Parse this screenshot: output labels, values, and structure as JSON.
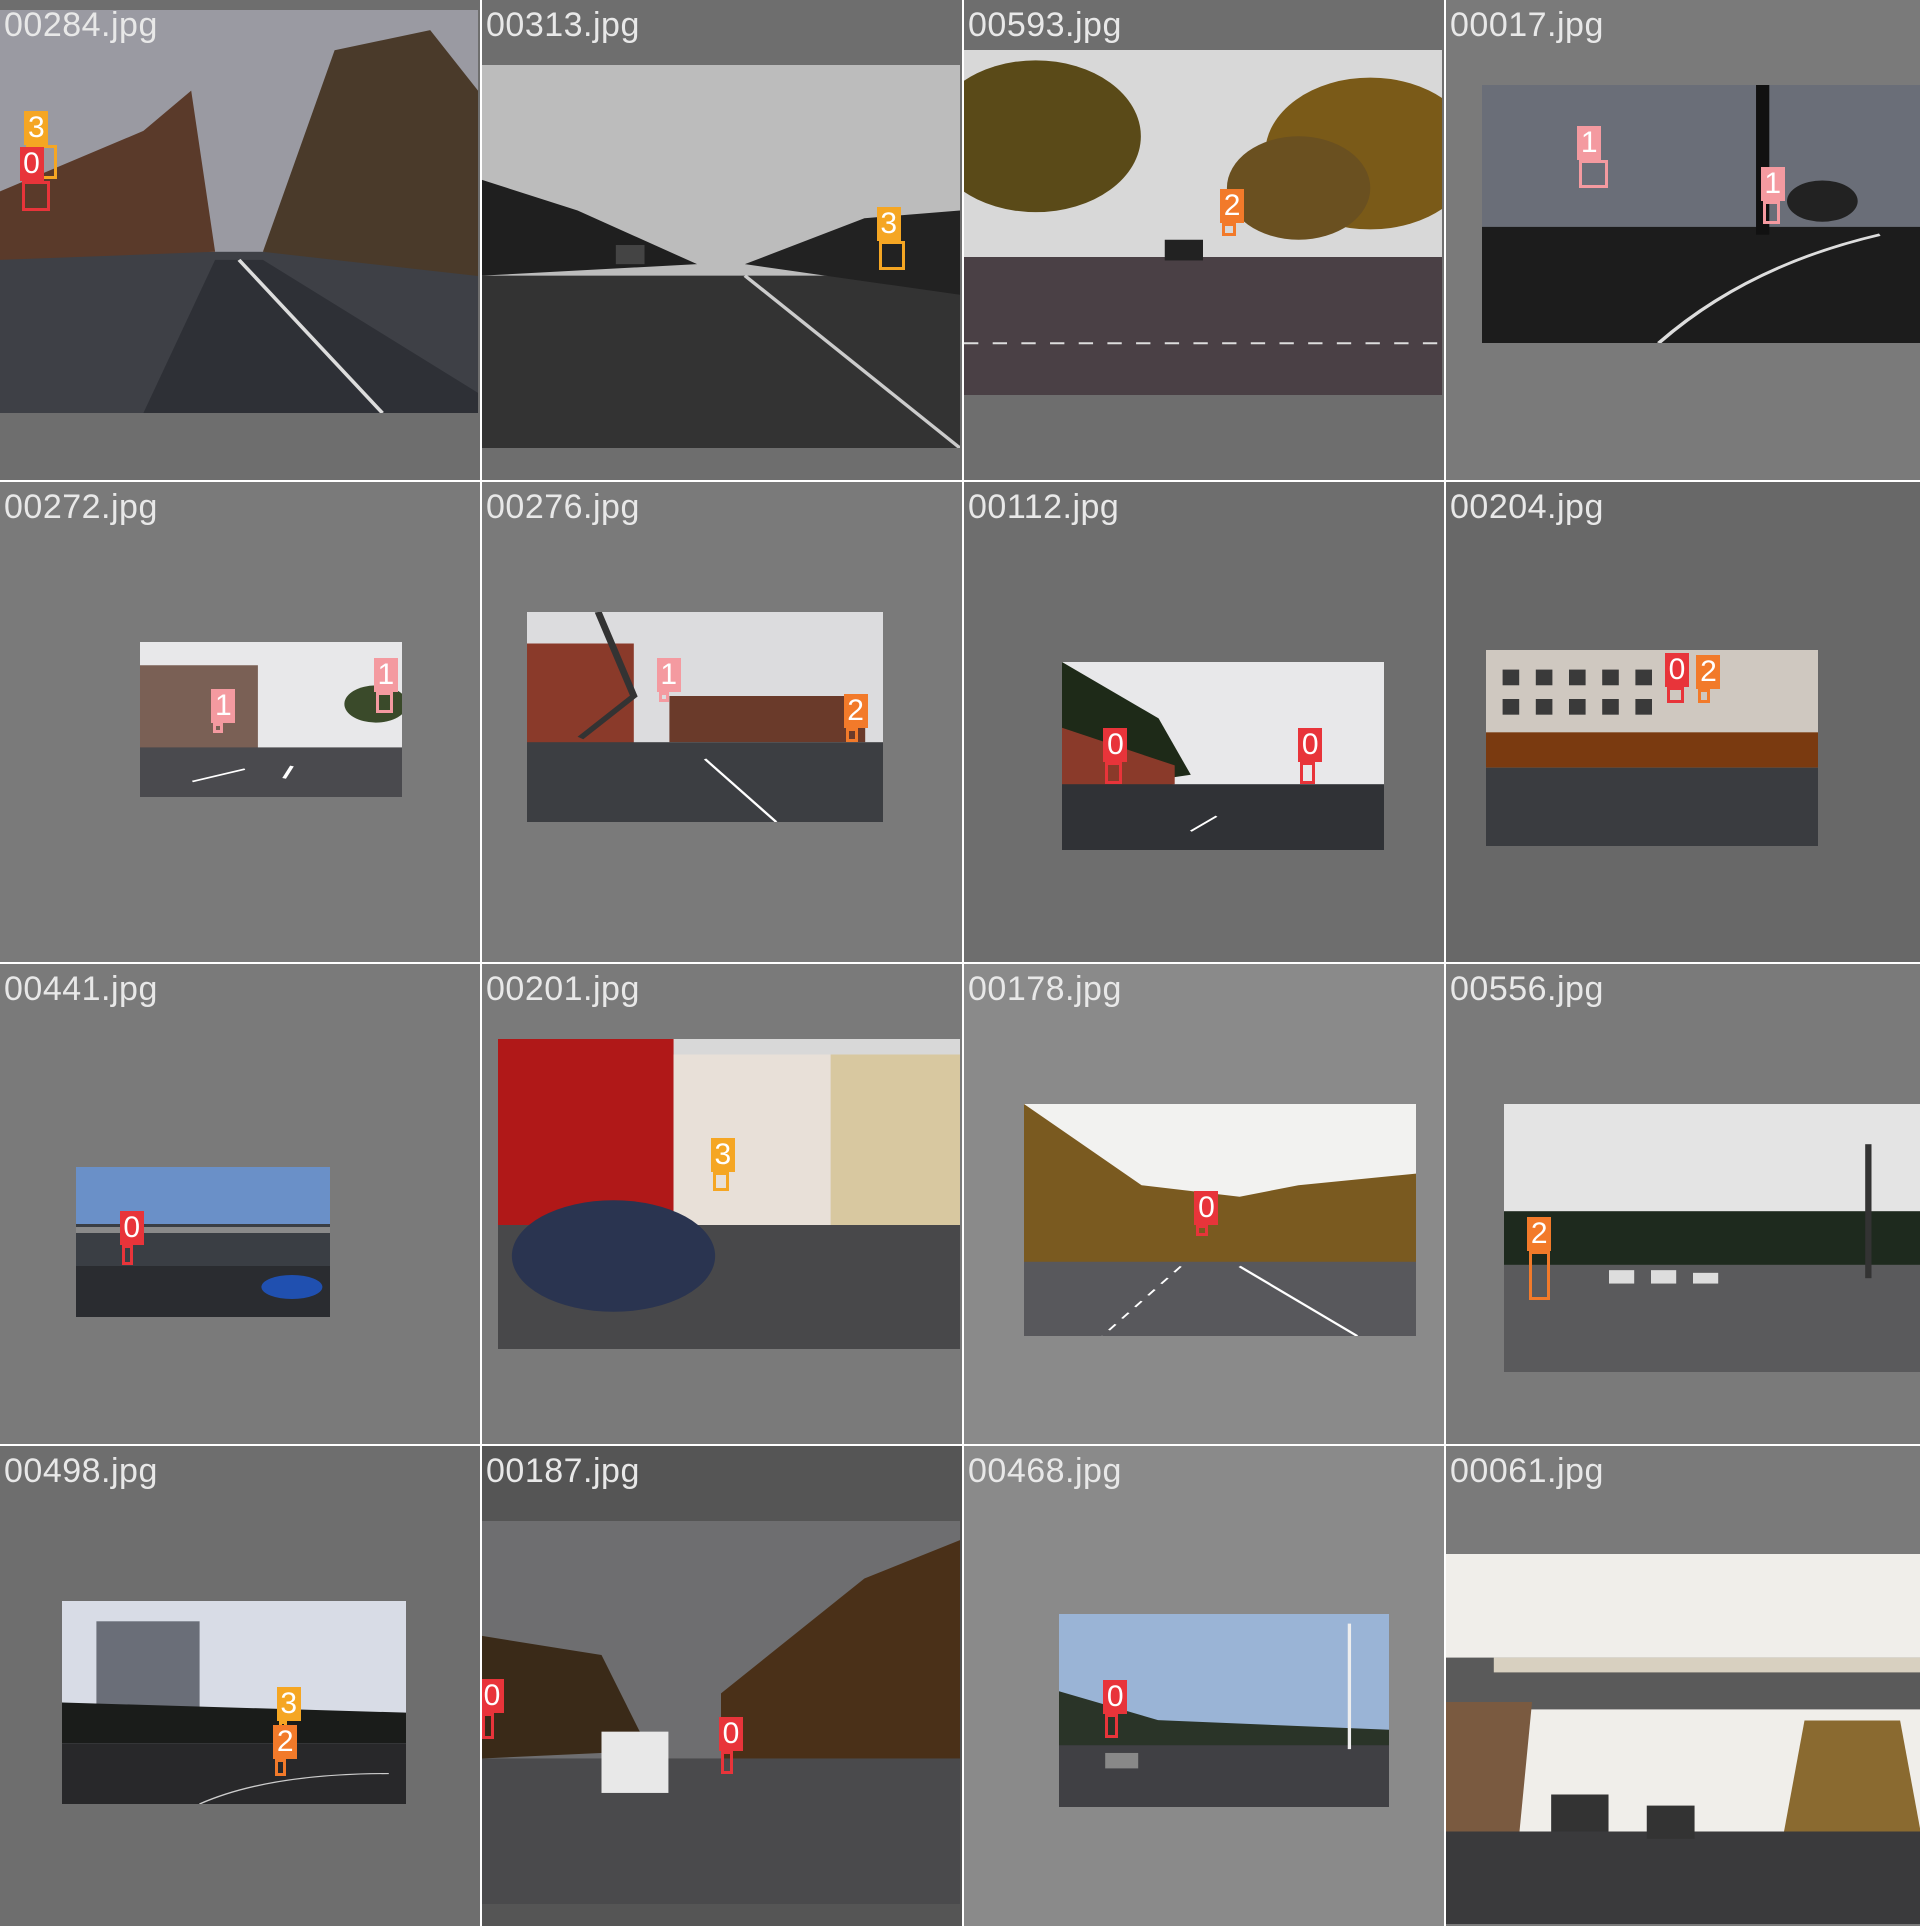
{
  "grid": {
    "columns": 4,
    "rows": 4
  },
  "class_colors": {
    "0": "#e8343a",
    "1": "#f49aa0",
    "2": "#f27a2a",
    "3": "#f5a623"
  },
  "tiles": [
    {
      "filename": "00284.jpg",
      "tile_bg": "#6e6e6e",
      "scene": "dusk-road",
      "detections": [
        {
          "cls": "3",
          "label": "3"
        },
        {
          "cls": "0",
          "label": "0"
        }
      ]
    },
    {
      "filename": "00313.jpg",
      "tile_bg": "#6e6e6e",
      "scene": "grey-highway",
      "detections": [
        {
          "cls": "3",
          "label": "3"
        }
      ]
    },
    {
      "filename": "00593.jpg",
      "tile_bg": "#6e6e6e",
      "scene": "autumn-avenue",
      "detections": [
        {
          "cls": "2",
          "label": "2"
        }
      ]
    },
    {
      "filename": "00017.jpg",
      "tile_bg": "#7a7a7a",
      "scene": "twilight-curve",
      "detections": [
        {
          "cls": "1",
          "label": "1"
        },
        {
          "cls": "1",
          "label": "1"
        }
      ]
    },
    {
      "filename": "00272.jpg",
      "tile_bg": "#7a7a7a",
      "scene": "town-street",
      "detections": [
        {
          "cls": "1",
          "label": "1"
        },
        {
          "cls": "1",
          "label": "1"
        }
      ]
    },
    {
      "filename": "00276.jpg",
      "tile_bg": "#7a7a7a",
      "scene": "junction",
      "detections": [
        {
          "cls": "1",
          "label": "1"
        },
        {
          "cls": "2",
          "label": "2"
        }
      ]
    },
    {
      "filename": "00112.jpg",
      "tile_bg": "#6e6e6e",
      "scene": "highway-wall",
      "detections": [
        {
          "cls": "0",
          "label": "0"
        },
        {
          "cls": "0",
          "label": "0"
        }
      ]
    },
    {
      "filename": "00204.jpg",
      "tile_bg": "#686868",
      "scene": "shopfronts",
      "detections": [
        {
          "cls": "0",
          "label": "0"
        },
        {
          "cls": "2",
          "label": "2"
        }
      ]
    },
    {
      "filename": "00441.jpg",
      "tile_bg": "#7a7a7a",
      "scene": "underpass",
      "detections": [
        {
          "cls": "0",
          "label": "0"
        }
      ]
    },
    {
      "filename": "00201.jpg",
      "tile_bg": "#7a7a7a",
      "scene": "houses",
      "detections": [
        {
          "cls": "3",
          "label": "3"
        }
      ]
    },
    {
      "filename": "00178.jpg",
      "tile_bg": "#8a8a8a",
      "scene": "autumn-road",
      "detections": [
        {
          "cls": "0",
          "label": "0"
        }
      ]
    },
    {
      "filename": "00556.jpg",
      "tile_bg": "#7a7a7a",
      "scene": "wet-intersection",
      "detections": [
        {
          "cls": "2",
          "label": "2"
        }
      ]
    },
    {
      "filename": "00498.jpg",
      "tile_bg": "#6e6e6e",
      "scene": "office-building",
      "detections": [
        {
          "cls": "3",
          "label": "3"
        },
        {
          "cls": "2",
          "label": "2"
        }
      ]
    },
    {
      "filename": "00187.jpg",
      "tile_bg": "#555555",
      "scene": "van-road",
      "detections": [
        {
          "cls": "0",
          "label": "0"
        },
        {
          "cls": "0",
          "label": "0"
        }
      ]
    },
    {
      "filename": "00468.jpg",
      "tile_bg": "#8a8a8a",
      "scene": "tram-road",
      "detections": [
        {
          "cls": "0",
          "label": "0"
        }
      ]
    },
    {
      "filename": "00061.jpg",
      "tile_bg": "#7a7a7a",
      "scene": "bridge",
      "detections": []
    }
  ]
}
